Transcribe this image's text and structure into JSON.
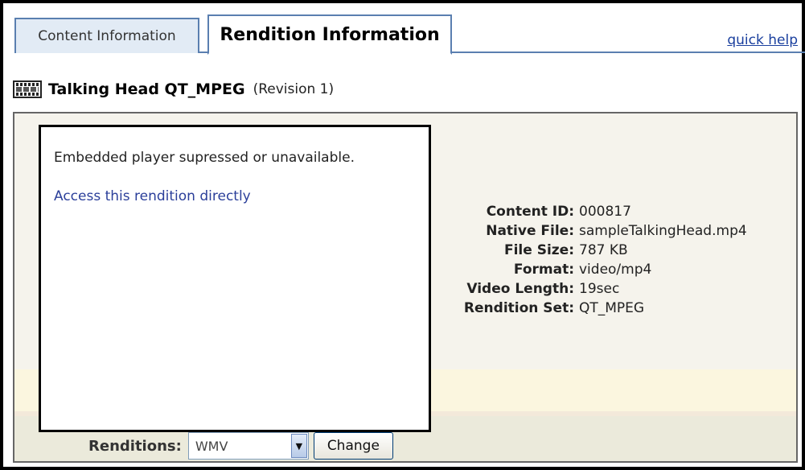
{
  "tabs": [
    {
      "label": "Content Information",
      "active": false
    },
    {
      "label": "Rendition Information",
      "active": true
    }
  ],
  "quick_help": "quick help",
  "header": {
    "icon": "film-icon",
    "title": "Talking Head QT_MPEG",
    "revision": "(Revision 1)"
  },
  "player": {
    "message": "Embedded player supressed or unavailable.",
    "link": "Access this rendition directly"
  },
  "info": [
    {
      "label": "Content ID:",
      "value": "000817"
    },
    {
      "label": "Native File:",
      "value": "sampleTalkingHead.mp4"
    },
    {
      "label": "File Size:",
      "value": "787 KB"
    },
    {
      "label": "Format:",
      "value": "video/mp4"
    },
    {
      "label": "Video Length:",
      "value": "19sec"
    },
    {
      "label": "Rendition Set:",
      "value": "QT_MPEG"
    }
  ],
  "renditions": {
    "label": "Renditions:",
    "selected": "WMV",
    "button": "Change"
  },
  "colors": {
    "tab_border": "#5a7fb0",
    "inactive_tab": "#e2ebf5",
    "link": "#2b3f9a",
    "panel_bg": "#f5f3ec"
  }
}
